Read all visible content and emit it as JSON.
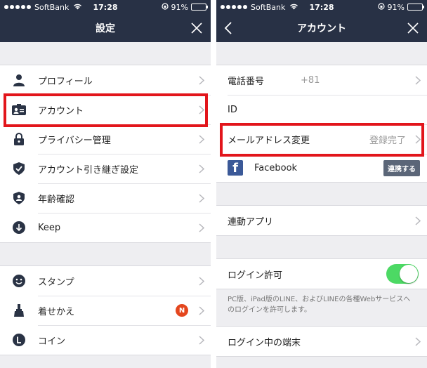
{
  "status": {
    "carrier": "SoftBank",
    "time": "17:28",
    "battery": "91%",
    "battery_level": 0.91
  },
  "left": {
    "title": "設定",
    "group1": [
      {
        "label": "プロフィール",
        "icon": "person-icon"
      },
      {
        "label": "アカウント",
        "icon": "id-card-icon"
      },
      {
        "label": "プライバシー管理",
        "icon": "lock-icon"
      },
      {
        "label": "アカウント引き継ぎ設定",
        "icon": "shield-check-icon"
      },
      {
        "label": "年齢確認",
        "icon": "shield-person-icon"
      },
      {
        "label": "Keep",
        "icon": "keep-icon"
      }
    ],
    "group2": [
      {
        "label": "スタンプ",
        "icon": "smiley-icon"
      },
      {
        "label": "着せかえ",
        "icon": "brush-icon",
        "badge": "N"
      },
      {
        "label": "コイン",
        "icon": "coin-icon"
      }
    ]
  },
  "right": {
    "title": "アカウント",
    "phone_label": "電話番号",
    "phone_value": "+81",
    "id_label": "ID",
    "email_label": "メールアドレス変更",
    "email_value": "登録完了",
    "facebook_label": "Facebook",
    "facebook_button": "連携する",
    "linked_apps_label": "連動アプリ",
    "login_allow_label": "ログイン許可",
    "login_allow_on": true,
    "login_allow_desc": "PC版、iPad版のLINE、およびLINEの各種Webサービスへのログインを許可します。",
    "logged_in_devices_label": "ログイン中の端末"
  },
  "colors": {
    "navbar": "#283145",
    "highlight": "#e2151b",
    "toggle_on": "#4cd964",
    "badge": "#e4461e"
  }
}
